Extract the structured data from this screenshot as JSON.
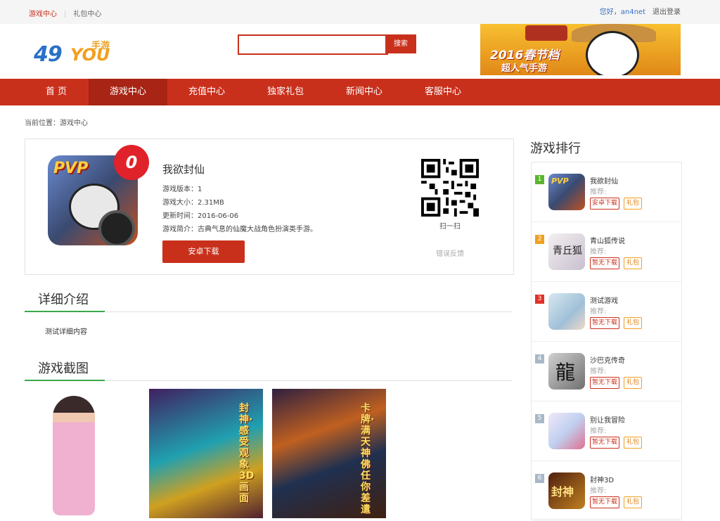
{
  "topbar": {
    "links": [
      "游戏中心",
      "礼包中心"
    ],
    "user": "您好，an4net",
    "logout": "退出登录"
  },
  "header": {
    "logo": {
      "num": "49",
      "you": "YOU",
      "suffix": "手游"
    },
    "search": {
      "placeholder": "",
      "button": "搜索"
    },
    "banner": {
      "line1": "2016春节档",
      "line2": "超人气手游"
    }
  },
  "nav": [
    "首 页",
    "游戏中心",
    "充值中心",
    "独家礼包",
    "新闻中心",
    "客服中心"
  ],
  "breadcrumb": "当前位置：游戏中心",
  "game": {
    "badge": "0",
    "icon_text": "PVP",
    "name": "我欲封仙",
    "version": "游戏版本：1",
    "size": "游戏大小：2.31MB",
    "updated": "更新时间：2016-06-06",
    "intro": "游戏简介：古典气息的仙魔大战角色扮演类手游。",
    "download": "安卓下载",
    "qr_caption": "扫一扫",
    "report": "错误反馈"
  },
  "detail": {
    "title": "详细介绍",
    "content": "测试详细内容"
  },
  "screenshots": {
    "title": "游戏截图",
    "shot2_text": "封神·感受观象3D画面",
    "shot3_text": "卡牌·满天神佛任你差遣"
  },
  "ranking": {
    "title": "游戏排行",
    "rec_label": "推荐:",
    "gift_label": "礼包",
    "items": [
      {
        "rank": "1",
        "name": "我欲封仙",
        "dl": "安卓下载",
        "color": "#5cb531",
        "icon_text": "PVP"
      },
      {
        "rank": "2",
        "name": "青山狐传说",
        "dl": "暂无下载",
        "color": "#f0a020",
        "icon_text": "青丘狐"
      },
      {
        "rank": "3",
        "name": "测试游戏",
        "dl": "暂无下载",
        "color": "#e0322a",
        "icon_text": ""
      },
      {
        "rank": "4",
        "name": "沙巴克传奇",
        "dl": "暂无下载",
        "color": "#a8b8c8",
        "icon_text": "龍"
      },
      {
        "rank": "5",
        "name": "别让我冒险",
        "dl": "暂无下载",
        "color": "#a8b8c8",
        "icon_text": ""
      },
      {
        "rank": "6",
        "name": "封神3D",
        "dl": "暂无下载",
        "color": "#a8b8c8",
        "icon_text": "封神"
      }
    ]
  }
}
